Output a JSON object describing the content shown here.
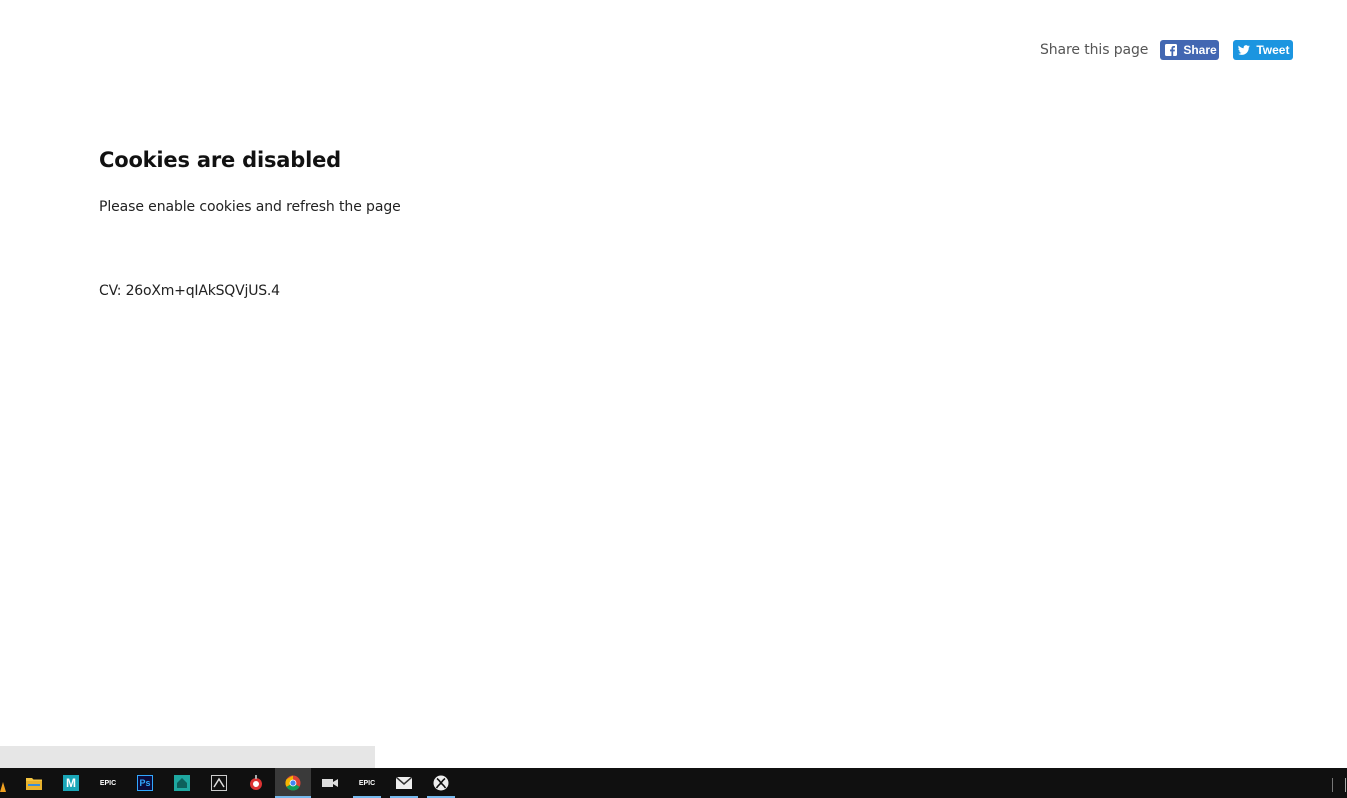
{
  "share": {
    "label": "Share this page",
    "facebook_label": "Share",
    "twitter_label": "Tweet"
  },
  "main": {
    "title": "Cookies are disabled",
    "message": "Please enable cookies and refresh the page",
    "cv": "CV: 26oXm+qIAkSQVjUS.4"
  },
  "taskbar": {
    "items": [
      {
        "name": "file-explorer",
        "icon": "folder-icon"
      },
      {
        "name": "maya",
        "icon": "maya-icon",
        "text": "M"
      },
      {
        "name": "epic-games",
        "icon": "epic-icon",
        "text": "EPIC"
      },
      {
        "name": "photoshop",
        "icon": "photoshop-icon",
        "text": "Ps"
      },
      {
        "name": "app-house",
        "icon": "house-app-icon"
      },
      {
        "name": "zbrush",
        "icon": "zbrush-icon"
      },
      {
        "name": "substance",
        "icon": "substance-icon"
      },
      {
        "name": "chrome",
        "icon": "chrome-icon"
      },
      {
        "name": "camera",
        "icon": "camera-icon"
      },
      {
        "name": "epic-games-2",
        "icon": "epic-icon",
        "text": "EPIC"
      },
      {
        "name": "mail",
        "icon": "mail-icon"
      },
      {
        "name": "xbox",
        "icon": "xbox-icon"
      }
    ]
  },
  "colors": {
    "facebook": "#4267b2",
    "twitter": "#1b95e0",
    "taskbar": "#101010",
    "active_indicator": "#76b9ed"
  }
}
